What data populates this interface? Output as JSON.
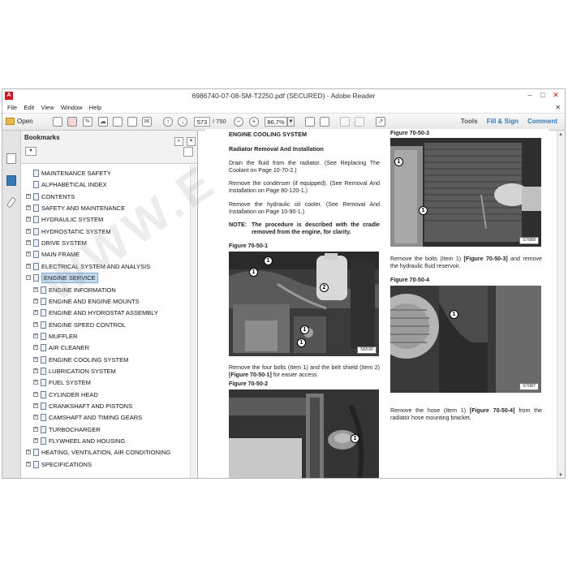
{
  "window": {
    "title": "6986740-07-08-SM-T2250.pdf (SECURED) - Adobe Reader"
  },
  "menu": [
    "File",
    "Edit",
    "View",
    "Window",
    "Help"
  ],
  "toolbar": {
    "open_label": "Open",
    "page_current": "573",
    "page_total": "/ 750",
    "zoom": "86,7%",
    "tools_label": "Tools",
    "fill_sign_label": "Fill & Sign",
    "comment_label": "Comment"
  },
  "bookmarks": {
    "header": "Bookmarks",
    "items": [
      {
        "label": "MAINTENANCE SAFETY",
        "level": 0,
        "expandable": false
      },
      {
        "label": "ALPHABETICAL INDEX",
        "level": 0,
        "expandable": false
      },
      {
        "label": "CONTENTS",
        "level": 0,
        "expandable": true
      },
      {
        "label": "SAFETY AND MAINTENANCE",
        "level": 0,
        "expandable": true
      },
      {
        "label": "HYDRAULIC SYSTEM",
        "level": 0,
        "expandable": true
      },
      {
        "label": "HYDROSTATIC SYSTEM",
        "level": 0,
        "expandable": true
      },
      {
        "label": "DRIVE SYSTEM",
        "level": 0,
        "expandable": true
      },
      {
        "label": "MAIN FRAME",
        "level": 0,
        "expandable": true
      },
      {
        "label": "ELECTRICAL SYSTEM AND ANALYSIS",
        "level": 0,
        "expandable": true
      },
      {
        "label": "ENGINE SERVICE",
        "level": 0,
        "expandable": true,
        "expanded": true,
        "selected": true
      },
      {
        "label": "ENGINE INFORMATION",
        "level": 1,
        "expandable": true
      },
      {
        "label": "ENGINE AND ENGINE MOUNTS",
        "level": 1,
        "expandable": true
      },
      {
        "label": "ENGINE AND HYDROSTAT ASSEMBLY",
        "level": 1,
        "expandable": true
      },
      {
        "label": "ENGINE SPEED CONTROL",
        "level": 1,
        "expandable": true
      },
      {
        "label": "MUFFLER",
        "level": 1,
        "expandable": true
      },
      {
        "label": "AIR CLEANER",
        "level": 1,
        "expandable": true
      },
      {
        "label": "ENGINE COOLING SYSTEM",
        "level": 1,
        "expandable": true
      },
      {
        "label": "LUBRICATION SYSTEM",
        "level": 1,
        "expandable": true
      },
      {
        "label": "FUEL SYSTEM",
        "level": 1,
        "expandable": true
      },
      {
        "label": "CYLINDER HEAD",
        "level": 1,
        "expandable": true
      },
      {
        "label": "CRANKSHAFT AND PISTONS",
        "level": 1,
        "expandable": true
      },
      {
        "label": "CAMSHAFT AND TIMING GEARS",
        "level": 1,
        "expandable": true
      },
      {
        "label": "TURBOCHARGER",
        "level": 1,
        "expandable": true
      },
      {
        "label": "FLYWHEEL AND HOUSING",
        "level": 1,
        "expandable": true
      },
      {
        "label": "HEATING, VENTILATION, AIR CONDITIONING",
        "level": 0,
        "expandable": true
      },
      {
        "label": "SPECIFICATIONS",
        "level": 0,
        "expandable": true
      }
    ]
  },
  "document": {
    "section_title": "ENGINE COOLING SYSTEM",
    "subsection_title": "Radiator Removal And Installation",
    "para1": "Drain the fluid from the radiator. (See Replacing The Coolant on Page 10-70-2.)",
    "para2": "Remove the condenser (if equipped). (See Removal And Installation on Page 80-120-1.)",
    "para3": "Remove the hydraulic oil cooler. (See Removal And Installation on Page 10-90-1.)",
    "note_label": "NOTE:",
    "note_text": "The procedure is described with the cradle removed from the engine, for clarity.",
    "fig1_title": "Figure 70-50-1",
    "fig1_code": "S6530",
    "fig1_caption_pre": "Remove the four bolts (Item 1) and the belt shield (Item 2)",
    "fig1_caption_ref": "[Figure 70-50-1]",
    "fig1_caption_post": "for easier access.",
    "fig2_title": "Figure 70-50-2",
    "fig3_title": "Figure 70-50-3",
    "fig3_code": "S7089",
    "fig3_caption_pre": "Remove the bolts (Item 1)",
    "fig3_caption_ref": "[Figure 70-50-3]",
    "fig3_caption_post": "and remove the hydraulic fluid reservoir.",
    "fig4_title": "Figure 70-50-4",
    "fig4_code": "S7087",
    "fig4_caption_pre": "Remove the hose (Item 1)",
    "fig4_caption_ref": "[Figure 70-50-4]",
    "fig4_caption_post": "from the radiator hose mounting bracket.",
    "callout_1": "1",
    "callout_2": "2"
  },
  "watermark": "WWW.E"
}
